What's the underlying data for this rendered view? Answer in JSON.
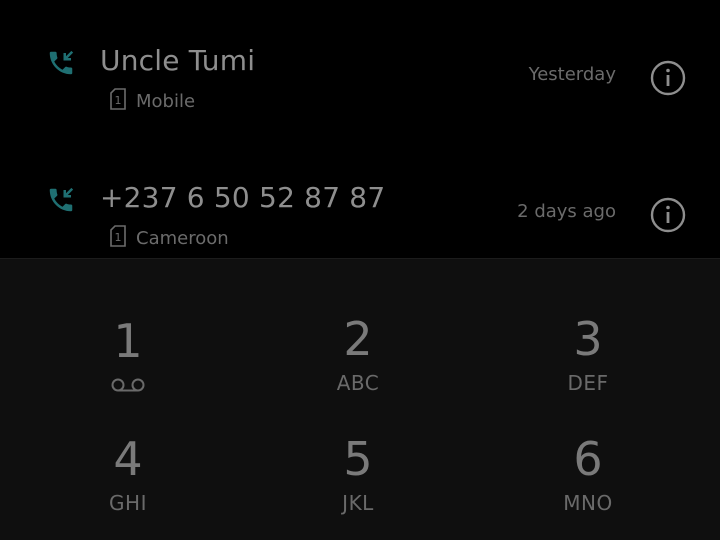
{
  "colors": {
    "background": "#000000",
    "keypad_background": "#0f0f0f",
    "call_icon": "#1f6f72",
    "primary_text": "#8e8e8e",
    "secondary_text": "#6b6b6b"
  },
  "call_log": [
    {
      "name": "Uncle Tumi",
      "sim": "1",
      "label": "Mobile",
      "time": "Yesterday",
      "call_icon": "incoming-call-icon",
      "info_icon": "info-icon"
    },
    {
      "name": "+237 6 50 52 87 87",
      "sim": "1",
      "label": "Cameroon",
      "time": "2 days ago",
      "call_icon": "incoming-call-icon",
      "info_icon": "info-icon"
    }
  ],
  "keypad": {
    "keys": [
      {
        "digit": "1",
        "letters": "",
        "icon": "voicemail-icon"
      },
      {
        "digit": "2",
        "letters": "ABC"
      },
      {
        "digit": "3",
        "letters": "DEF"
      },
      {
        "digit": "4",
        "letters": "GHI"
      },
      {
        "digit": "5",
        "letters": "JKL"
      },
      {
        "digit": "6",
        "letters": "MNO"
      }
    ]
  }
}
